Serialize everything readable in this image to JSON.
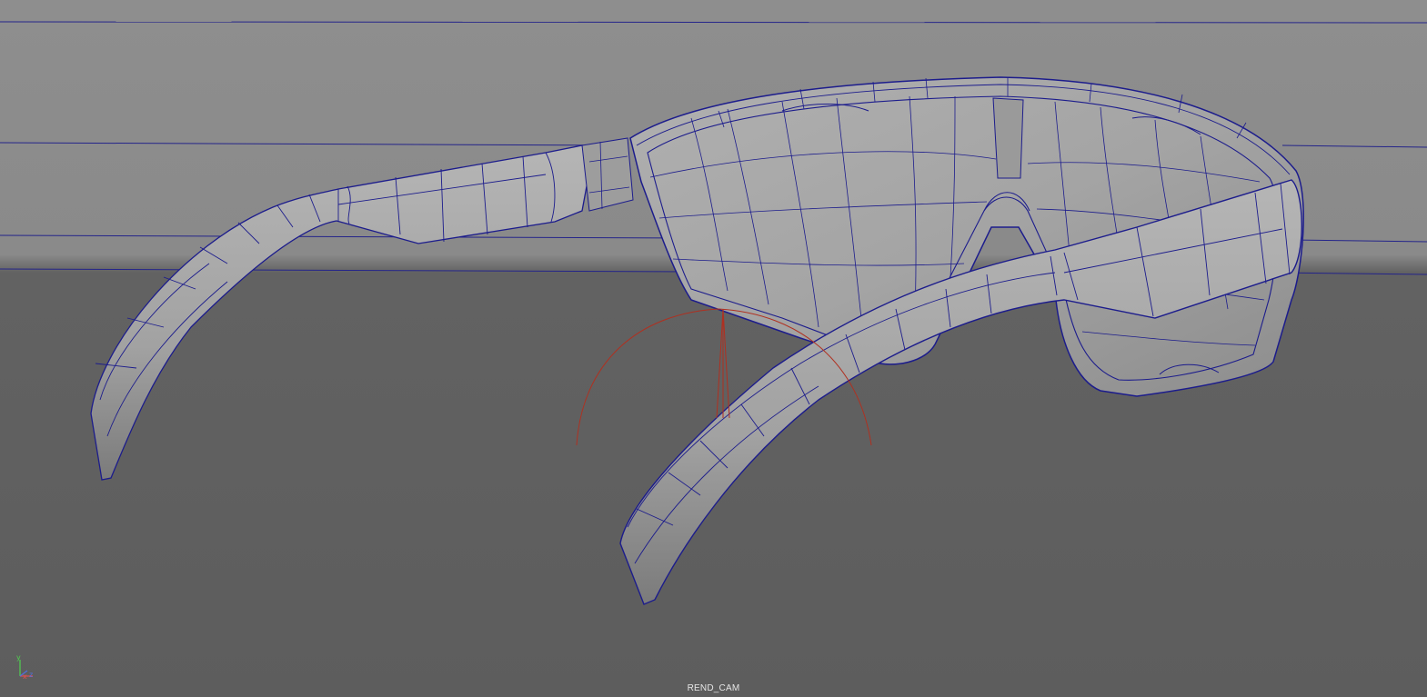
{
  "viewport": {
    "camera_name": "REND_CAM",
    "model": "sunglasses-wireframe-on-shaded",
    "colors": {
      "background_top": "#8e8e8e",
      "background_bottom": "#5d5d5d",
      "wireframe": "#1c1c8c",
      "surface": "#a9a9a9",
      "surface_shadow": "#7a7a7a",
      "camera_rig": "#b03020"
    }
  },
  "axis_gizmo": {
    "y_label": "y",
    "x_label": "x",
    "z_label": "z",
    "colors": {
      "x": "#e05050",
      "y": "#50d050",
      "z": "#5070e0"
    }
  }
}
